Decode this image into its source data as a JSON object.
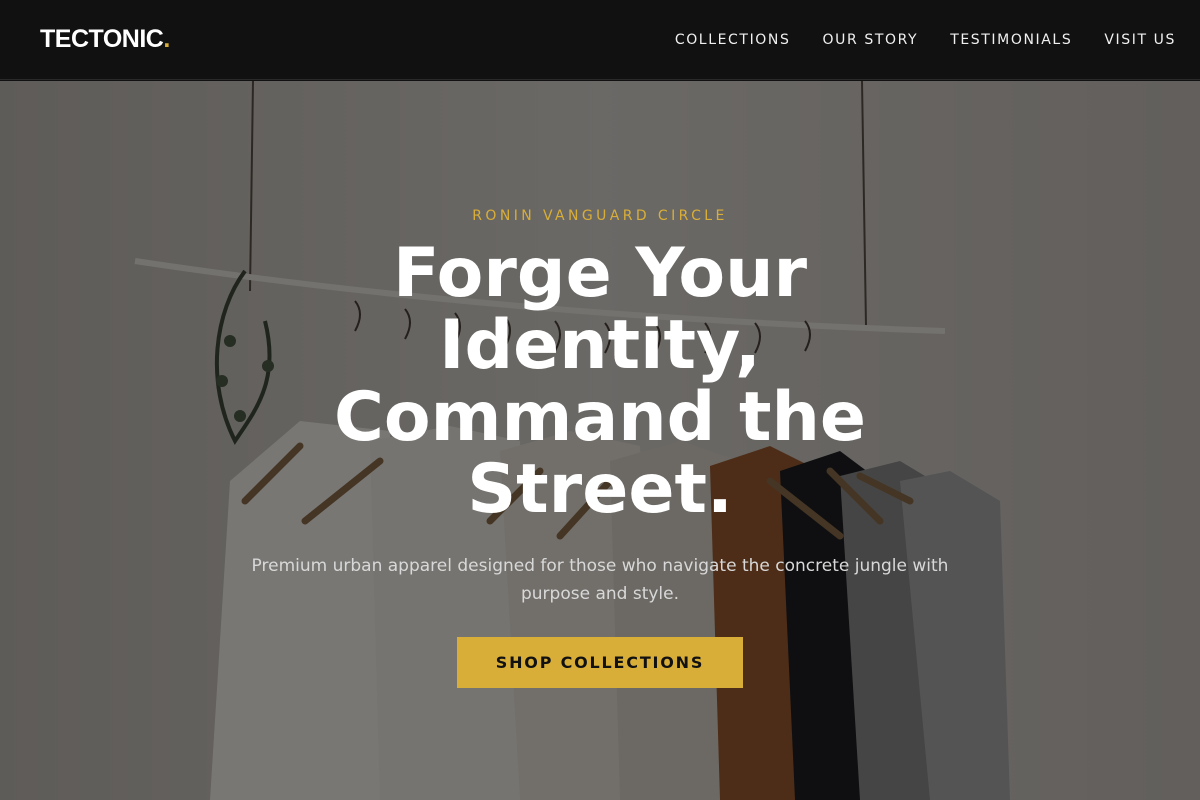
{
  "brand": {
    "name": "TECTONIC",
    "dot": ".",
    "accent_color": "#d9ae38"
  },
  "nav": {
    "items": [
      {
        "label": "COLLECTIONS"
      },
      {
        "label": "OUR STORY"
      },
      {
        "label": "TESTIMONIALS"
      },
      {
        "label": "VISIT US"
      }
    ]
  },
  "hero": {
    "eyebrow": "RONIN VANGUARD CIRCLE",
    "headline": "Forge Your Identity, Command the Street.",
    "subtext": "Premium urban apparel designed for those who navigate the concrete jungle with purpose and style.",
    "cta_label": "SHOP COLLECTIONS",
    "background_image": "clothing-rack-photo"
  }
}
